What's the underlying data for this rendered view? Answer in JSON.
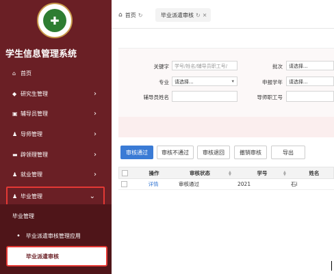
{
  "sidebar": {
    "logo_glyph": "✚",
    "app_title": "学生信息管理系统",
    "items": [
      {
        "icon": "home-icon",
        "glyph": "⌂",
        "label": "首页"
      },
      {
        "icon": "graduation-cap-icon",
        "glyph": "◆",
        "label": "研究生管理"
      },
      {
        "icon": "id-card-icon",
        "glyph": "▣",
        "label": "辅导员管理"
      },
      {
        "icon": "user-group-icon",
        "glyph": "♟",
        "label": "导师管理"
      },
      {
        "icon": "card-icon",
        "glyph": "▬",
        "label": "辟领理管理"
      },
      {
        "icon": "user-group-icon",
        "glyph": "♟",
        "label": "就业管理"
      },
      {
        "icon": "user-group-icon",
        "glyph": "♟",
        "label": "毕业管理"
      }
    ],
    "submenu": [
      {
        "label": "毕业管理"
      },
      {
        "label": "毕业派遣审核管理应用"
      },
      {
        "label": "毕业派遣审核"
      }
    ]
  },
  "tabs": {
    "home": "首页",
    "active": "毕业派遣审核"
  },
  "search_form": {
    "keyword_label": "关键字",
    "keyword_placeholder": "学号/姓名/辅导员职工号/",
    "batch_label": "批次",
    "batch_value": "请选择...",
    "major_label": "专业",
    "major_value": "请选择...",
    "apply_year_label": "申报学年",
    "apply_year_value": "请选择...",
    "counselor_name_label": "辅导员姓名",
    "mentor_id_label": "导师职工号"
  },
  "toolbar": {
    "approve": "审核通过",
    "reject": "审核不通过",
    "return": "审核退回",
    "revoke": "撤销审核",
    "export": "导出"
  },
  "table": {
    "headers": [
      "操作",
      "审核状态",
      "学号",
      "姓名"
    ],
    "rows": [
      {
        "action": "详情",
        "status": "审核通过",
        "student_id": "2021",
        "name": "石i"
      }
    ]
  },
  "colors": {
    "sidebar_bg": "#6a1f25",
    "primary": "#3a7bd5",
    "highlight": "#e53935"
  }
}
